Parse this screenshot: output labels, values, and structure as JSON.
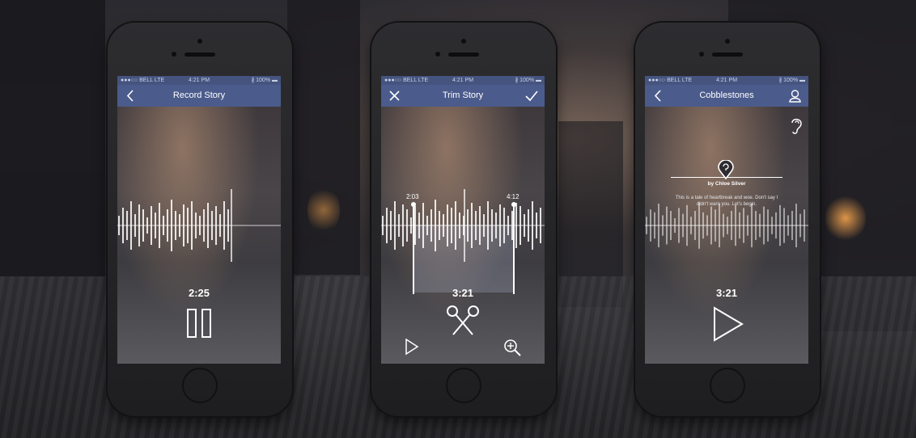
{
  "status_bar": {
    "carrier": "●●●○○ BELL  LTE",
    "time": "4:21 PM",
    "battery": "∦ 100% ▬"
  },
  "screens": [
    {
      "nav_title": "Record Story",
      "timer": "2:25"
    },
    {
      "nav_title": "Trim Story",
      "timer": "3:21",
      "trim_start": "2:03",
      "trim_end": "4:12"
    },
    {
      "nav_title": "Cobblestones",
      "timer": "3:21",
      "author": "by Chloe Silver",
      "description": "This is a tale of heartbreak and woe. Don't say I didn't warn you. Let's begin."
    }
  ],
  "icons": {
    "back": "chevron-left-icon",
    "close": "close-icon",
    "confirm": "checkmark-icon",
    "profile": "user-icon",
    "listen": "ear-icon",
    "location": "map-pin-icon",
    "pause": "pause-icon",
    "play": "play-icon",
    "scissors": "scissors-icon",
    "zoom": "zoom-in-icon"
  },
  "colors": {
    "navbar": "#4b5b8c",
    "status_bar": "#45547f"
  }
}
